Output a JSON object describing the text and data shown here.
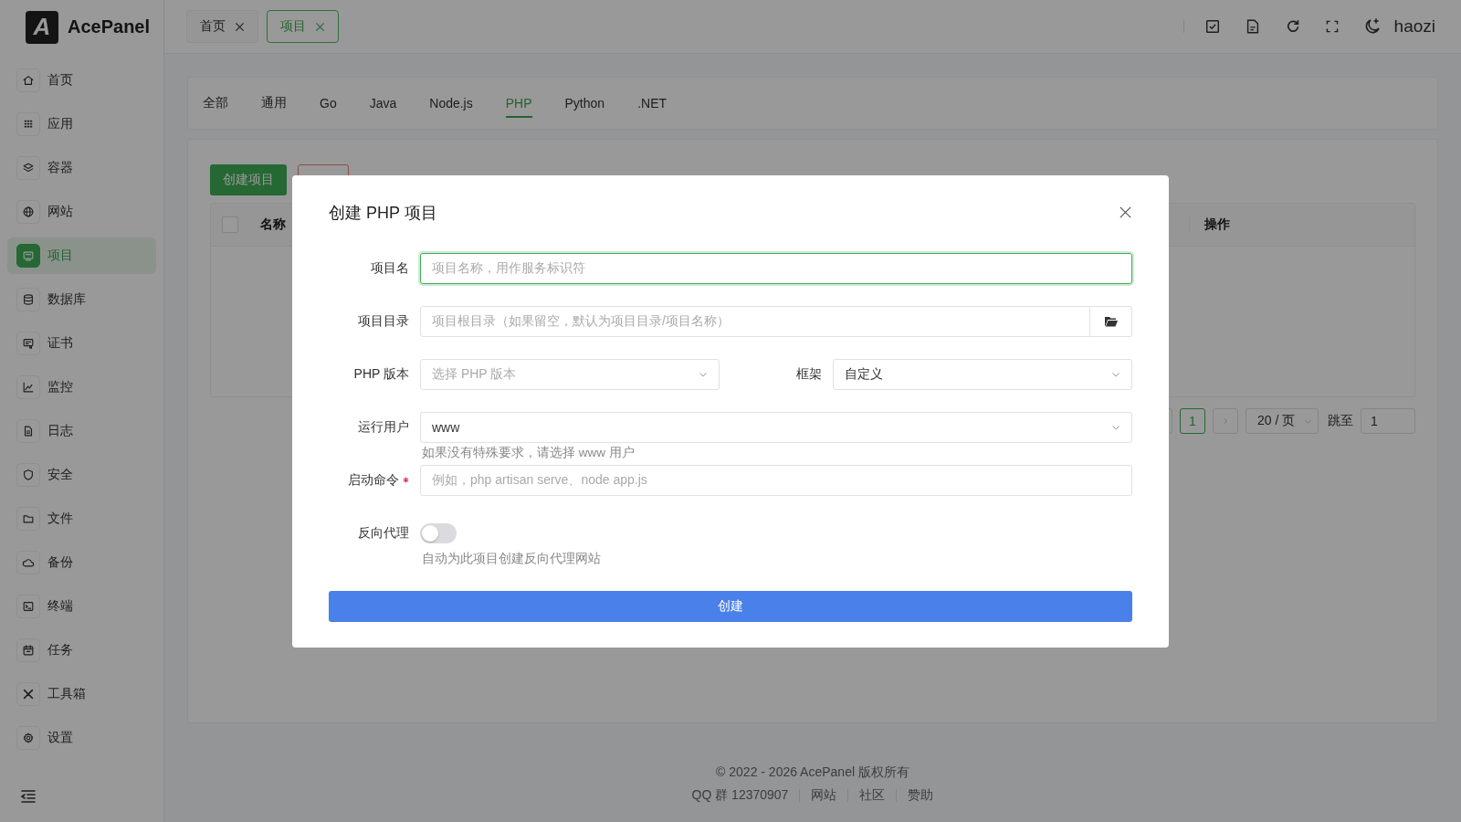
{
  "logo": {
    "mark": "A",
    "name": "AcePanel"
  },
  "sidebar": {
    "items": [
      {
        "label": "首页",
        "selected": false
      },
      {
        "label": "应用",
        "selected": false
      },
      {
        "label": "容器",
        "selected": false
      },
      {
        "label": "网站",
        "selected": false
      },
      {
        "label": "项目",
        "selected": true
      },
      {
        "label": "数据库",
        "selected": false
      },
      {
        "label": "证书",
        "selected": false
      },
      {
        "label": "监控",
        "selected": false
      },
      {
        "label": "日志",
        "selected": false
      },
      {
        "label": "安全",
        "selected": false
      },
      {
        "label": "文件",
        "selected": false
      },
      {
        "label": "备份",
        "selected": false
      },
      {
        "label": "终端",
        "selected": false
      },
      {
        "label": "任务",
        "selected": false
      },
      {
        "label": "工具箱",
        "selected": false
      },
      {
        "label": "设置",
        "selected": false
      }
    ]
  },
  "header": {
    "tabs": [
      {
        "label": "首页",
        "selected": false
      },
      {
        "label": "项目",
        "selected": true
      }
    ],
    "user": "haozi"
  },
  "category_tabs": [
    {
      "label": "全部",
      "selected": false
    },
    {
      "label": "通用",
      "selected": false
    },
    {
      "label": "Go",
      "selected": false
    },
    {
      "label": "Java",
      "selected": false
    },
    {
      "label": "Node.js",
      "selected": false
    },
    {
      "label": "PHP",
      "selected": true
    },
    {
      "label": "Python",
      "selected": false
    },
    {
      "label": ".NET",
      "selected": false
    }
  ],
  "toolbar": {
    "create_button": "创建项目"
  },
  "table": {
    "select_all_checked": false,
    "columns": [
      "名称",
      "操作"
    ]
  },
  "pagination": {
    "pages": [
      {
        "label": "1",
        "selected": true
      }
    ],
    "page_size": "20 / 页",
    "jump_label": "跳至",
    "jump_value": "1"
  },
  "dialog": {
    "title": "创建 PHP 项目",
    "fields": [
      {
        "kind": "input",
        "label": "项目名",
        "placeholder": "项目名称，用作服务标识符",
        "focused": true
      },
      {
        "kind": "folder",
        "label": "项目目录",
        "placeholder": "项目根目录（如果留空，默认为项目目录/项目名称）"
      },
      {
        "kind": "pair",
        "items": [
          {
            "label": "PHP 版本",
            "placeholder": "选择 PHP 版本"
          },
          {
            "label": "框架",
            "value": "自定义"
          }
        ]
      },
      {
        "kind": "select",
        "label": "运行用户",
        "value": "www",
        "help": "如果没有特殊要求，请选择 www 用户"
      },
      {
        "kind": "input",
        "label": "启动命令",
        "required": true,
        "placeholder": "例如，php artisan serve、node app.js",
        "focused": false
      },
      {
        "kind": "switch",
        "label": "反向代理",
        "on": false,
        "help": "自动为此项目创建反向代理网站"
      }
    ],
    "submit": "创建"
  },
  "footer": {
    "copyright": "© 2022 - 2026 AcePanel 版权所有",
    "links": [
      "QQ 群 12370907",
      "网站",
      "社区",
      "赞助"
    ]
  }
}
